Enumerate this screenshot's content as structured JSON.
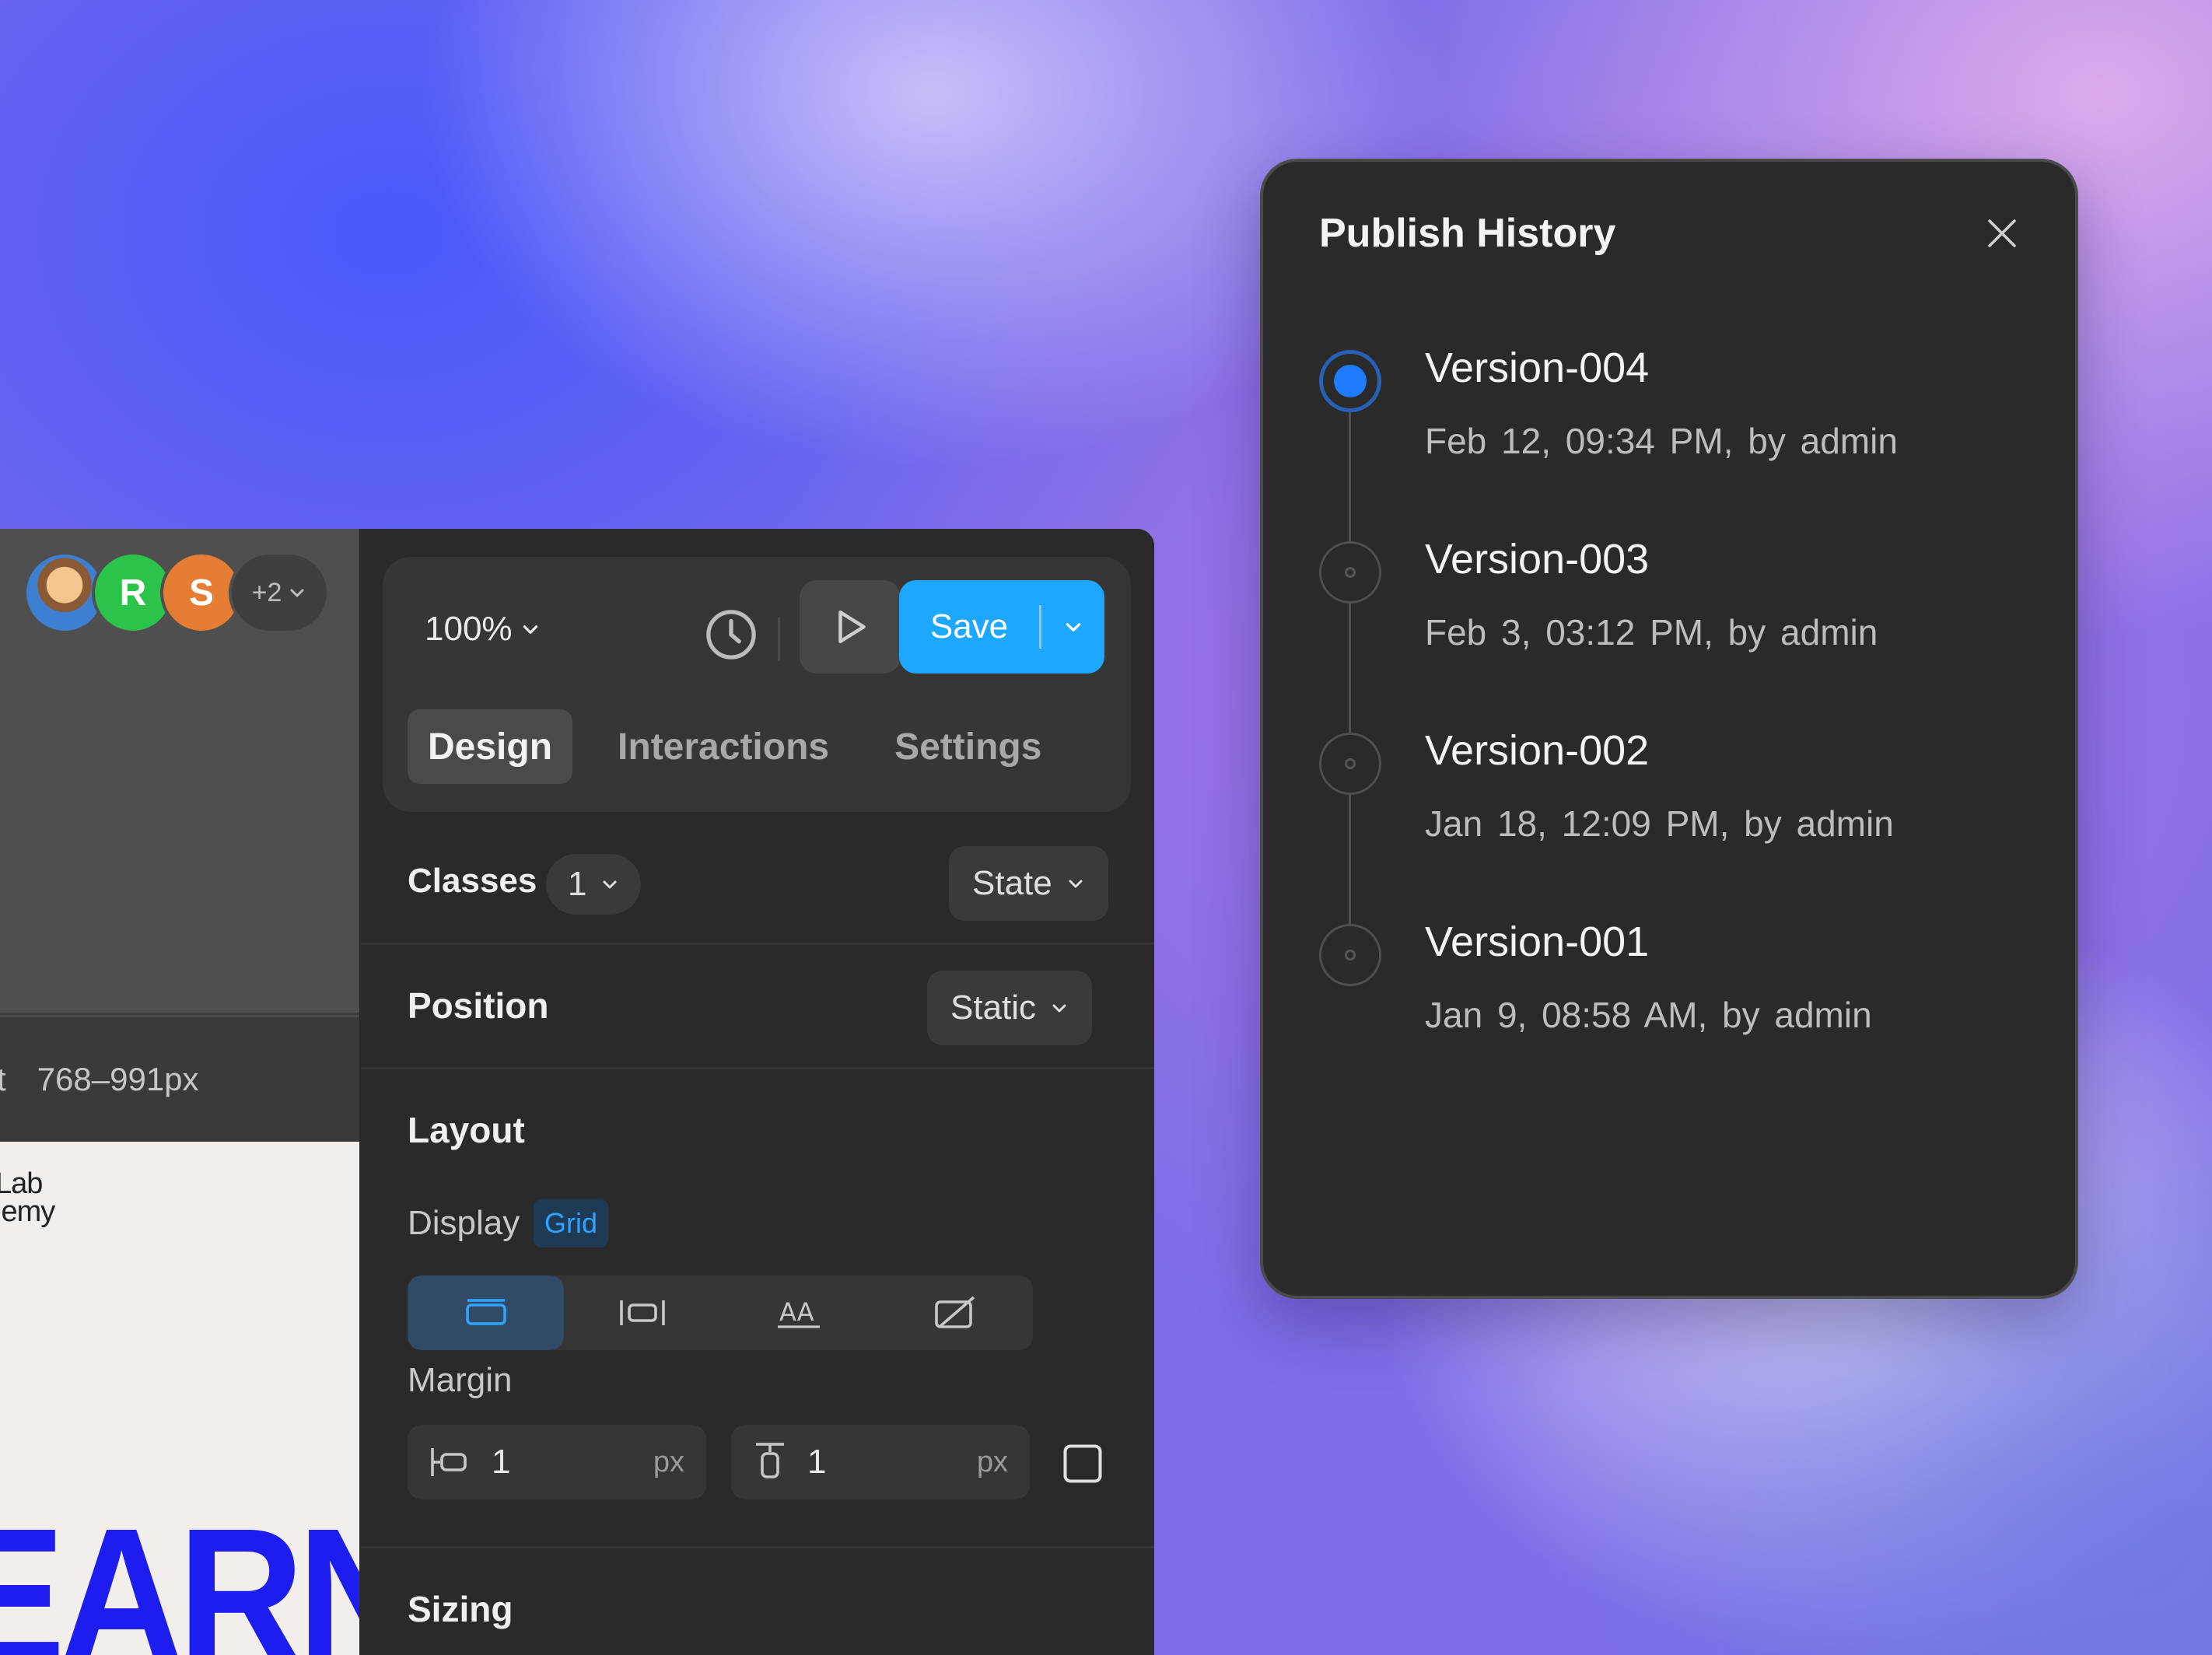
{
  "collaborators": {
    "avatars": [
      {
        "kind": "photo",
        "initial": ""
      },
      {
        "kind": "letter",
        "initial": "R",
        "color": "#2bc34a"
      },
      {
        "kind": "letter",
        "initial": "S",
        "color": "#e57e34"
      }
    ],
    "more_label": "+2"
  },
  "breakpoint": {
    "prefix": "t",
    "range": "768–991px"
  },
  "canvas_preview": {
    "brand_line_1": "Lab",
    "brand_line_2": "lemy",
    "headline": "EARN"
  },
  "toolbar": {
    "zoom": "100%",
    "history_icon": "clock-icon",
    "preview_icon": "play-icon",
    "save_label": "Save",
    "save_color": "#1ea7ff"
  },
  "tabs": [
    {
      "label": "Design",
      "active": true
    },
    {
      "label": "Interactions",
      "active": false
    },
    {
      "label": "Settings",
      "active": false
    }
  ],
  "classes": {
    "label": "Classes",
    "count": "1",
    "state_label": "State"
  },
  "position": {
    "label": "Position",
    "value": "Static"
  },
  "layout": {
    "label": "Layout",
    "display_label": "Display",
    "display_value": "Grid",
    "display_options": [
      {
        "icon": "block-display-icon",
        "active": true
      },
      {
        "icon": "flex-display-icon",
        "active": false
      },
      {
        "icon": "inline-display-icon",
        "active": false
      },
      {
        "icon": "display-none-icon",
        "active": false
      }
    ],
    "margin_label": "Margin",
    "margin_horizontal": {
      "value": "1",
      "unit": "px"
    },
    "margin_vertical": {
      "value": "1",
      "unit": "px"
    }
  },
  "sizing": {
    "label": "Sizing"
  },
  "publish_history": {
    "title": "Publish History",
    "versions": [
      {
        "name": "Version-004",
        "date": "Feb 12,",
        "time": "09:34 PM,",
        "author": "by admin",
        "current": true
      },
      {
        "name": "Version-003",
        "date": "Feb 3,",
        "time": "03:12 PM,",
        "author": "by admin",
        "current": false
      },
      {
        "name": "Version-002",
        "date": "Jan 18,",
        "time": "12:09 PM,",
        "author": "by admin",
        "current": false
      },
      {
        "name": "Version-001",
        "date": "Jan 9,",
        "time": "08:58 AM,",
        "author": "by admin",
        "current": false
      }
    ]
  }
}
